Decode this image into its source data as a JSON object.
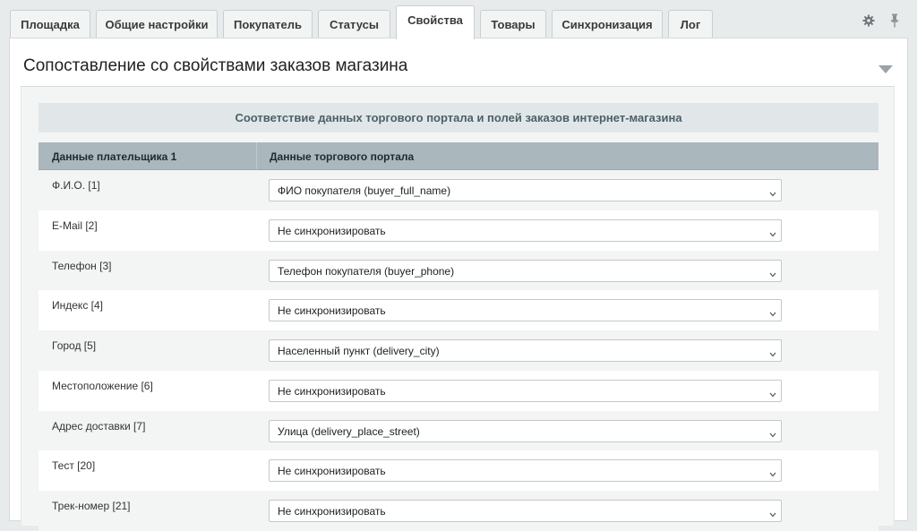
{
  "tabs": [
    {
      "label": "Площадка",
      "active": false
    },
    {
      "label": "Общие настройки",
      "active": false
    },
    {
      "label": "Покупатель",
      "active": false
    },
    {
      "label": "Статусы",
      "active": false
    },
    {
      "label": "Свойства",
      "active": true
    },
    {
      "label": "Товары",
      "active": false
    },
    {
      "label": "Синхронизация",
      "active": false
    },
    {
      "label": "Лог",
      "active": false
    }
  ],
  "toolbar_icons": [
    "gear-icon",
    "pin-icon"
  ],
  "panel": {
    "title": "Сопоставление со свойствами заказов магазина",
    "section_title": "Соответствие данных торгового портала и полей заказов интернет-магазина",
    "table": {
      "col1": "Данные плательщика 1",
      "col2": "Данные торгового портала"
    },
    "rows": [
      {
        "label": "Ф.И.О. [1]",
        "value": "ФИО покупателя (buyer_full_name)"
      },
      {
        "label": "E-Mail [2]",
        "value": "Не синхронизировать"
      },
      {
        "label": "Телефон [3]",
        "value": "Телефон покупателя (buyer_phone)"
      },
      {
        "label": "Индекс [4]",
        "value": "Не синхронизировать"
      },
      {
        "label": "Город [5]",
        "value": "Населенный пункт (delivery_city)"
      },
      {
        "label": "Местоположение [6]",
        "value": "Не синхронизировать"
      },
      {
        "label": "Адрес доставки [7]",
        "value": "Улица (delivery_place_street)"
      },
      {
        "label": "Тест [20]",
        "value": "Не синхронизировать"
      },
      {
        "label": "Трек-номер [21]",
        "value": "Не синхронизировать"
      }
    ]
  },
  "colors": {
    "header_row": "#aab7bd",
    "section_head": "#e1e7e9",
    "page_bg": "#e8ebec"
  }
}
